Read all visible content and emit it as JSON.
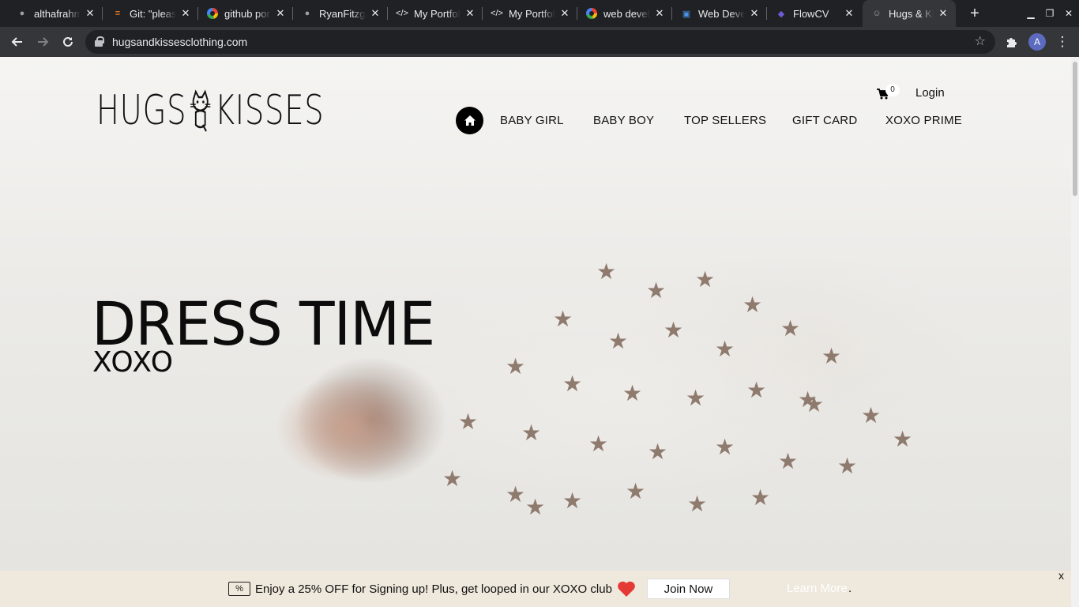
{
  "browser": {
    "tabs": [
      {
        "title": "althafrahman",
        "icon": "github-icon"
      },
      {
        "title": "Git: \"please",
        "icon": "stackoverflow-icon"
      },
      {
        "title": "github portfolio",
        "icon": "google-icon"
      },
      {
        "title": "RyanFitzgerald",
        "icon": "github-icon"
      },
      {
        "title": "My Portfolio",
        "icon": "code-icon"
      },
      {
        "title": "My Portfolio",
        "icon": "code-icon"
      },
      {
        "title": "web developer",
        "icon": "google-icon"
      },
      {
        "title": "Web Developer",
        "icon": "document-icon"
      },
      {
        "title": "FlowCV",
        "icon": "flowcv-icon"
      },
      {
        "title": "Hugs & Kisses",
        "icon": "cat-icon",
        "active": true
      }
    ],
    "url": "hugsandkissesclothing.com",
    "profile_initial": "A"
  },
  "site": {
    "logo_left": "HUGS",
    "logo_right": "KISSES",
    "cart_count": "0",
    "login": "Login",
    "nav": [
      "BABY GIRL",
      "BABY BOY",
      "TOP SELLERS",
      "GIFT CARD",
      "XOXO PRIME"
    ],
    "hero": {
      "title": "DRESS TIME",
      "subtitle": "XOXO"
    },
    "promo": {
      "text": "Enjoy a 25% OFF for Signing up! Plus, get looped in our XOXO club",
      "coupon_symbol": "%",
      "join_button": "Join Now",
      "learn_more": "Learn More",
      "trailing": ".",
      "close": "x"
    }
  },
  "colors": {
    "accent": "#000000",
    "promo_bg": "#efe8dc",
    "heart": "#e53935"
  }
}
